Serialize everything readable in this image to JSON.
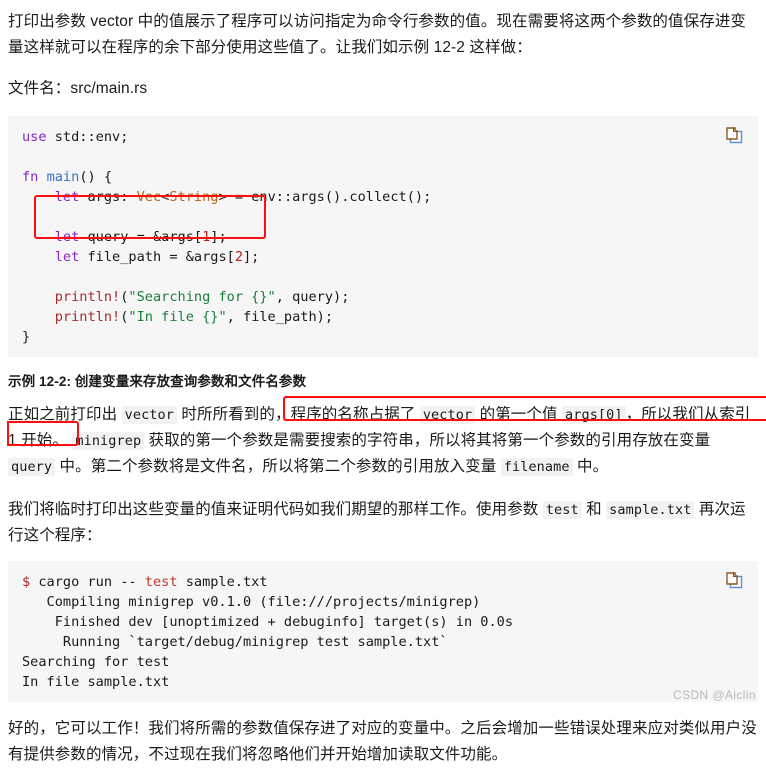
{
  "document": {
    "intro_paragraph": "打印出参数 vector 中的值展示了程序可以访问指定为命令行参数的值。现在需要将这两个参数的值保存进变量这样就可以在程序的余下部分使用这些值了。让我们如示例 12-2 这样做：",
    "filename_label": "文件名：src/main.rs",
    "caption": "示例 12-2: 创建变量来存放查询参数和文件名参数",
    "as_before": {
      "seg1": "正如之前打印出 ",
      "code1": "vector",
      "seg2": " 时所所看到的，",
      "highlight_seg1": "程序的名称占据了 ",
      "highlight_code": "vector",
      "highlight_seg2": " 的第一个值 ",
      "highlight_code2": "args[0]",
      "highlight_seg3": "，所以我们从索引 1 开始。",
      "seg3": " ",
      "code2": "minigrep",
      "seg4": " 获取的第一个参数是需要搜索的字符串，所以将其将第一个参数的引用存放在变量 ",
      "code3": "query",
      "seg5": " 中。第二个参数将是文件名，所以将第二个参数的引用放入变量 ",
      "code4": "filename",
      "seg6": " 中。"
    },
    "temp_print": {
      "seg1": "我们将临时打印出这些变量的值来证明代码如我们期望的那样工作。使用参数 ",
      "code1": "test",
      "seg2": " 和 ",
      "code2": "sample.txt",
      "seg3": " 再次运行这个程序："
    },
    "closing_paragraph": "好的，它可以工作！我们将所需的参数值保存进了对应的变量中。之后会增加一些错误处理来应对类似用户没有提供参数的情况，不过现在我们将忽略他们并开始增加读取文件功能。"
  },
  "code_block": {
    "icon": "copy-icon",
    "language": "rust",
    "lines": [
      {
        "tokens": [
          {
            "t": "use",
            "c": "kw"
          },
          {
            "t": " std::env;",
            "c": "pl"
          }
        ]
      },
      {
        "tokens": [
          {
            "t": "",
            "c": "pl"
          }
        ]
      },
      {
        "tokens": [
          {
            "t": "fn ",
            "c": "kw"
          },
          {
            "t": "main",
            "c": "fnm"
          },
          {
            "t": "() {",
            "c": "pl"
          }
        ]
      },
      {
        "tokens": [
          {
            "t": "    ",
            "c": "pl"
          },
          {
            "t": "let",
            "c": "kw"
          },
          {
            "t": " args: ",
            "c": "pl"
          },
          {
            "t": "Vec",
            "c": "typ"
          },
          {
            "t": "<",
            "c": "pl"
          },
          {
            "t": "String",
            "c": "typ"
          },
          {
            "t": "> = env::args().collect();",
            "c": "pl"
          }
        ]
      },
      {
        "tokens": [
          {
            "t": "",
            "c": "pl"
          }
        ]
      },
      {
        "tokens": [
          {
            "t": "    ",
            "c": "pl"
          },
          {
            "t": "let",
            "c": "kw"
          },
          {
            "t": " query = &args[",
            "c": "pl"
          },
          {
            "t": "1",
            "c": "num"
          },
          {
            "t": "];",
            "c": "pl"
          }
        ]
      },
      {
        "tokens": [
          {
            "t": "    ",
            "c": "pl"
          },
          {
            "t": "let",
            "c": "kw"
          },
          {
            "t": " file_path = &args[",
            "c": "pl"
          },
          {
            "t": "2",
            "c": "num"
          },
          {
            "t": "];",
            "c": "pl"
          }
        ]
      },
      {
        "tokens": [
          {
            "t": "",
            "c": "pl"
          }
        ]
      },
      {
        "tokens": [
          {
            "t": "    ",
            "c": "pl"
          },
          {
            "t": "println!",
            "c": "mac"
          },
          {
            "t": "(",
            "c": "pl"
          },
          {
            "t": "\"Searching for {}\"",
            "c": "str"
          },
          {
            "t": ", query);",
            "c": "pl"
          }
        ]
      },
      {
        "tokens": [
          {
            "t": "    ",
            "c": "pl"
          },
          {
            "t": "println!",
            "c": "mac"
          },
          {
            "t": "(",
            "c": "pl"
          },
          {
            "t": "\"In file {}\"",
            "c": "str"
          },
          {
            "t": ", file_path);",
            "c": "pl"
          }
        ]
      },
      {
        "tokens": [
          {
            "t": "}",
            "c": "pl"
          }
        ]
      }
    ]
  },
  "terminal_block": {
    "icon": "copy-icon",
    "lines": [
      {
        "tokens": [
          {
            "t": "$",
            "c": "sh-dollar"
          },
          {
            "t": " cargo run -- ",
            "c": "sh-plain"
          },
          {
            "t": "test",
            "c": "sh-arg"
          },
          {
            "t": " sample.txt",
            "c": "sh-plain"
          }
        ]
      },
      {
        "tokens": [
          {
            "t": "   Compiling minigrep v0.1.0 (file:///projects/minigrep)",
            "c": "sh-plain"
          }
        ]
      },
      {
        "tokens": [
          {
            "t": "    Finished dev [unoptimized + debuginfo] target(s) in 0.0s",
            "c": "sh-plain"
          }
        ]
      },
      {
        "tokens": [
          {
            "t": "     Running `target/debug/minigrep test sample.txt`",
            "c": "sh-plain"
          }
        ]
      },
      {
        "tokens": [
          {
            "t": "Searching for test",
            "c": "sh-plain"
          }
        ]
      },
      {
        "tokens": [
          {
            "t": "In file sample.txt",
            "c": "sh-plain"
          }
        ]
      }
    ]
  },
  "annotations": {
    "highlight_color": "#fb0f0f",
    "code_box_label": "let-bindings-highlight",
    "text_box_label": "index-explanation-highlight"
  },
  "watermark": "CSDN @Aiclin"
}
